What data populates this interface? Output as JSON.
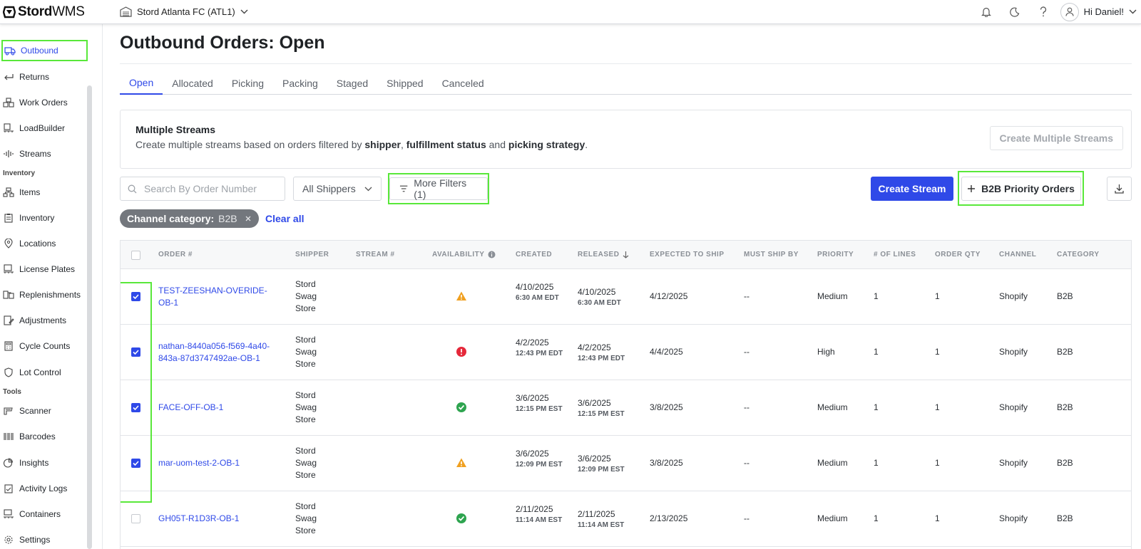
{
  "topbar": {
    "logo_brand": "Stord",
    "logo_product": "WMS",
    "facility": "Stord Atlanta FC (ATL1)",
    "greeting": "Hi Daniel!"
  },
  "sidebar": {
    "items": [
      {
        "label": "Outbound",
        "icon": "truck-icon"
      },
      {
        "label": "Returns",
        "icon": "return-arrow-icon"
      },
      {
        "label": "Work Orders",
        "icon": "boxes-icon"
      },
      {
        "label": "LoadBuilder",
        "icon": "pallet-icon"
      },
      {
        "label": "Streams",
        "icon": "waveform-icon"
      },
      {
        "label": "Items",
        "icon": "item-hierarchy-icon"
      },
      {
        "label": "Inventory",
        "icon": "clipboard-icon"
      },
      {
        "label": "Locations",
        "icon": "location-pin-icon"
      },
      {
        "label": "License Plates",
        "icon": "pallet-icon"
      },
      {
        "label": "Replenishments",
        "icon": "replenish-icon"
      },
      {
        "label": "Adjustments",
        "icon": "edit-document-icon"
      },
      {
        "label": "Cycle Counts",
        "icon": "calculator-icon"
      },
      {
        "label": "Lot Control",
        "icon": "shield-icon"
      },
      {
        "label": "Scanner",
        "icon": "scanner-icon"
      },
      {
        "label": "Barcodes",
        "icon": "barcode-icon"
      },
      {
        "label": "Insights",
        "icon": "pie-chart-icon"
      },
      {
        "label": "Activity Logs",
        "icon": "activity-log-icon"
      },
      {
        "label": "Containers",
        "icon": "container-icon"
      },
      {
        "label": "Settings",
        "icon": "gear-icon"
      }
    ],
    "sections": {
      "inventory": "Inventory",
      "tools": "Tools"
    }
  },
  "main": {
    "title": "Outbound Orders: Open",
    "tabs": [
      "Open",
      "Allocated",
      "Picking",
      "Packing",
      "Staged",
      "Shipped",
      "Canceled"
    ],
    "active_tab": "Open",
    "streams_card": {
      "title": "Multiple Streams",
      "desc_prefix": "Create multiple streams based on orders filtered by ",
      "bold1": "shipper",
      "sep1": ", ",
      "bold2": "fulfillment status",
      "sep2": " and ",
      "bold3": "picking strategy",
      "suffix": ".",
      "button": "Create Multiple Streams"
    },
    "toolbar": {
      "search_placeholder": "Search By Order Number",
      "shippers": "All Shippers",
      "more_filters": "More Filters (1)",
      "create_stream": "Create Stream",
      "b2b_button": "B2B Priority Orders"
    },
    "chip": {
      "key": "Channel category:",
      "value": "B2B"
    },
    "clear_all": "Clear all"
  },
  "table": {
    "columns": [
      "ORDER #",
      "SHIPPER",
      "STREAM #",
      "AVAILABILITY",
      "CREATED",
      "RELEASED",
      "EXPECTED TO SHIP",
      "MUST SHIP BY",
      "PRIORITY",
      "# OF LINES",
      "ORDER QTY",
      "CHANNEL",
      "CATEGORY"
    ],
    "rows": [
      {
        "checked": true,
        "order": "TEST-ZEESHAN-OVERIDE-OB-1",
        "shipper": "Stord Swag Store",
        "stream": "",
        "availability": "warning",
        "created_date": "4/10/2025",
        "created_time": "6:30 AM EDT",
        "released_date": "4/10/2025",
        "released_time": "6:30 AM EDT",
        "expected": "4/12/2025",
        "must_ship": "--",
        "priority": "Medium",
        "lines": "1",
        "qty": "1",
        "channel": "Shopify",
        "category": "B2B"
      },
      {
        "checked": true,
        "order": "nathan-8440a056-f569-4a40-843a-87d3747492ae-OB-1",
        "shipper": "Stord Swag Store",
        "stream": "",
        "availability": "error",
        "created_date": "4/2/2025",
        "created_time": "12:43 PM EDT",
        "released_date": "4/2/2025",
        "released_time": "12:43 PM EDT",
        "expected": "4/4/2025",
        "must_ship": "--",
        "priority": "High",
        "lines": "1",
        "qty": "1",
        "channel": "Shopify",
        "category": "B2B"
      },
      {
        "checked": true,
        "order": "FACE-OFF-OB-1",
        "shipper": "Stord Swag Store",
        "stream": "",
        "availability": "ok",
        "created_date": "3/6/2025",
        "created_time": "12:15 PM EST",
        "released_date": "3/6/2025",
        "released_time": "12:15 PM EST",
        "expected": "3/8/2025",
        "must_ship": "--",
        "priority": "Medium",
        "lines": "1",
        "qty": "1",
        "channel": "Shopify",
        "category": "B2B"
      },
      {
        "checked": true,
        "order": "mar-uom-test-2-OB-1",
        "shipper": "Stord Swag Store",
        "stream": "",
        "availability": "warning",
        "created_date": "3/6/2025",
        "created_time": "12:09 PM EST",
        "released_date": "3/6/2025",
        "released_time": "12:09 PM EST",
        "expected": "3/8/2025",
        "must_ship": "--",
        "priority": "Medium",
        "lines": "1",
        "qty": "1",
        "channel": "Shopify",
        "category": "B2B"
      },
      {
        "checked": false,
        "order": "GH05T-R1D3R-OB-1",
        "shipper": "Stord Swag Store",
        "stream": "",
        "availability": "ok",
        "created_date": "2/11/2025",
        "created_time": "11:14 AM EST",
        "released_date": "2/11/2025",
        "released_time": "11:14 AM EST",
        "expected": "2/13/2025",
        "must_ship": "--",
        "priority": "Medium",
        "lines": "1",
        "qty": "1",
        "channel": "Shopify",
        "category": "B2B"
      }
    ]
  },
  "colors": {
    "accent": "#2f49e8",
    "highlight": "#59e83a",
    "warning": "#f0a020",
    "error": "#e5283a",
    "ok": "#2ea44f"
  }
}
